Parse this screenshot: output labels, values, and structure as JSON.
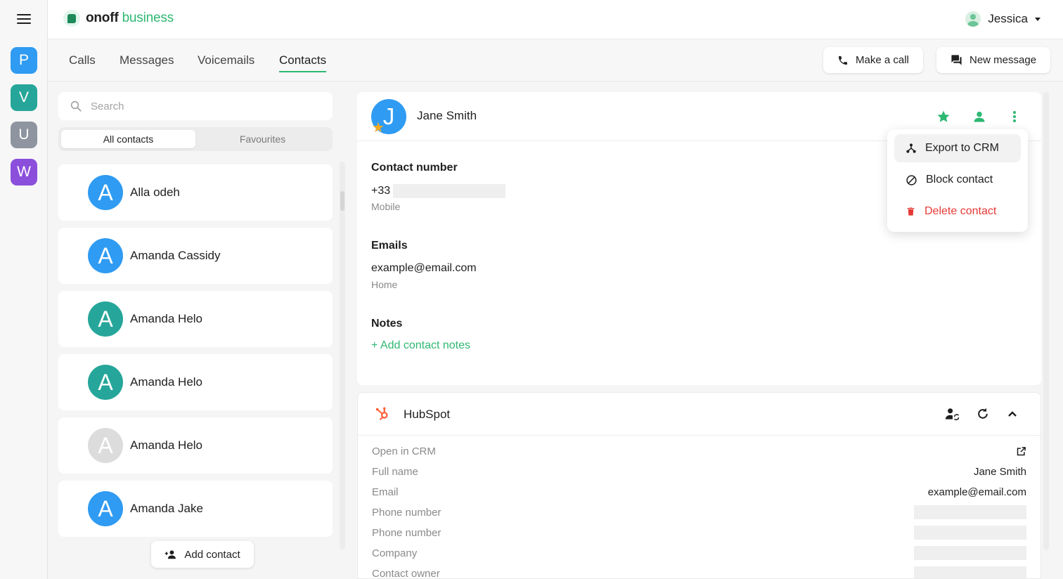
{
  "brand": {
    "bold": "onoff",
    "light": " business"
  },
  "user": {
    "name": "Jessica"
  },
  "workspaces": [
    {
      "letter": "P",
      "color": "#2f9bf2"
    },
    {
      "letter": "V",
      "color": "#26a69a"
    },
    {
      "letter": "U",
      "color": "#8e95a0"
    },
    {
      "letter": "W",
      "color": "#8b4fdc"
    }
  ],
  "tabs": [
    "Calls",
    "Messages",
    "Voicemails",
    "Contacts"
  ],
  "active_tab": "Contacts",
  "actions": {
    "make_call": "Make a call",
    "new_message": "New message"
  },
  "search": {
    "placeholder": "Search"
  },
  "filters": {
    "all": "All contacts",
    "favourites": "Favourites"
  },
  "contacts": [
    {
      "initial": "A",
      "name": "Alla odeh",
      "color": "#2f9bf2"
    },
    {
      "initial": "A",
      "name": "Amanda Cassidy",
      "color": "#2f9bf2"
    },
    {
      "initial": "A",
      "name": "Amanda Helo",
      "color": "#26a69a"
    },
    {
      "initial": "A",
      "name": "Amanda Helo",
      "color": "#26a69a"
    },
    {
      "initial": "A",
      "name": "Amanda Helo",
      "color": "#dcdcdc"
    },
    {
      "initial": "A",
      "name": "Amanda Jake",
      "color": "#2f9bf2"
    }
  ],
  "add_contact": "Add contact",
  "detail": {
    "initial": "J",
    "name": "Jane Smith",
    "contact_number_label": "Contact number",
    "phone_prefix": "+33",
    "phone_type": "Mobile",
    "emails_label": "Emails",
    "email": "example@email.com",
    "email_type": "Home",
    "notes_label": "Notes",
    "add_notes": "+ Add contact notes"
  },
  "menu": {
    "export": "Export to CRM",
    "block": "Block contact",
    "delete": "Delete contact"
  },
  "hubspot": {
    "title": "HubSpot",
    "rows": [
      {
        "label": "Open in CRM",
        "value": ""
      },
      {
        "label": "Full name",
        "value": "Jane Smith"
      },
      {
        "label": "Email",
        "value": "example@email.com"
      },
      {
        "label": "Phone number",
        "value": ""
      },
      {
        "label": "Phone number",
        "value": ""
      },
      {
        "label": "Company",
        "value": ""
      },
      {
        "label": "Contact owner",
        "value": ""
      }
    ]
  },
  "colors": {
    "accent": "#2eb872",
    "danger": "#e53935",
    "star": "#f4a922",
    "hubspot": "#ff5c35"
  }
}
